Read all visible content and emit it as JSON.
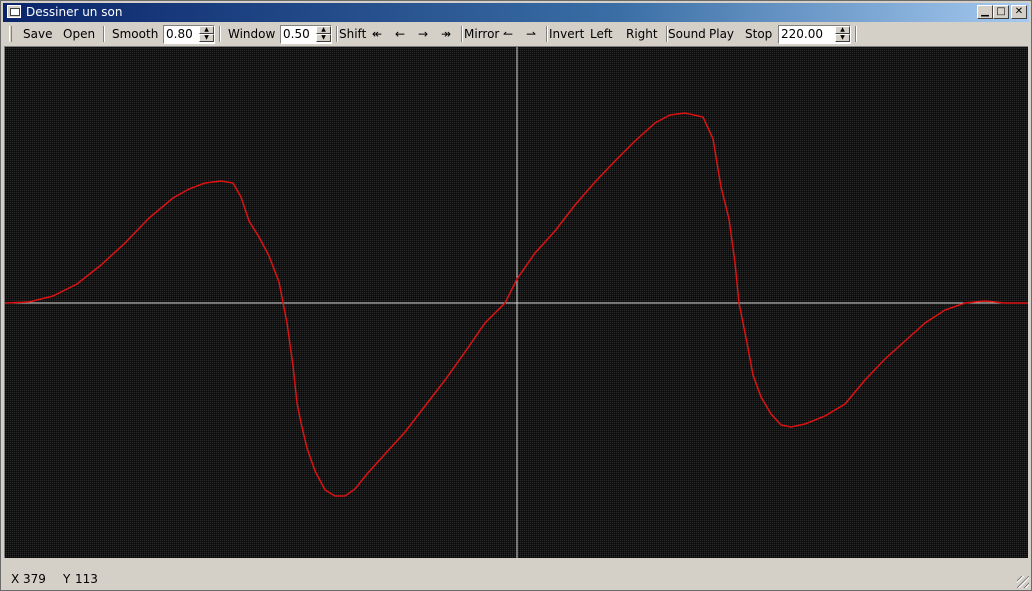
{
  "window": {
    "title": "Dessiner un son"
  },
  "toolbar": {
    "save": "Save",
    "open": "Open",
    "smooth_label": "Smooth",
    "smooth_value": "0.80",
    "window_label": "Window",
    "window_value": "0.50",
    "shift_label": "Shift",
    "shift_far_left": "↞",
    "shift_left": "←",
    "shift_right": "→",
    "shift_far_right": "↠",
    "mirror_label": "Mirror",
    "mirror_left": "↼",
    "mirror_right": "⇀",
    "invert": "Invert",
    "left": "Left",
    "right": "Right",
    "sound_label": "Sound",
    "play": "Play",
    "stop": "Stop",
    "frequency_value": "220.00"
  },
  "status": {
    "x_label": "X",
    "x_value": "379",
    "y_label": "Y",
    "y_value": "113"
  },
  "colors": {
    "curve": "#e01010",
    "axes": "#d8d8d8",
    "canvas_bg": "#2a2a2a"
  },
  "chart_data": {
    "type": "line",
    "x": [
      0,
      24,
      48,
      72,
      96,
      120,
      144,
      168,
      184,
      200,
      216,
      228,
      236,
      244,
      254,
      264,
      274,
      282,
      288,
      292,
      296,
      302,
      310,
      320,
      330,
      340,
      350,
      362,
      380,
      400,
      420,
      440,
      460,
      480,
      500,
      512,
      530,
      550,
      570,
      590,
      610,
      630,
      650,
      665,
      680,
      698,
      708,
      716,
      724,
      730,
      734,
      738,
      742,
      748,
      756,
      766,
      776,
      786,
      800,
      820,
      840,
      860,
      880,
      900,
      920,
      940,
      960,
      980,
      1000,
      1023
    ],
    "values": [
      0,
      1,
      7,
      19,
      38,
      60,
      85,
      105,
      114,
      120,
      122,
      120,
      106,
      82,
      66,
      47,
      21,
      -20,
      -63,
      -100,
      -120,
      -145,
      -168,
      -187,
      -193,
      -193,
      -186,
      -171,
      -151,
      -129,
      -103,
      -77,
      -49,
      -20,
      0,
      24,
      50,
      72,
      98,
      121,
      142,
      162,
      180,
      188,
      190,
      186,
      164,
      116,
      84,
      40,
      0,
      -20,
      -40,
      -72,
      -94,
      -111,
      -122,
      -124,
      -121,
      -113,
      -101,
      -77,
      -56,
      -38,
      -20,
      -7,
      0,
      2,
      0,
      0
    ],
    "xlim": [
      0,
      1023
    ],
    "ylim": [
      -256,
      256
    ],
    "grid": true
  }
}
